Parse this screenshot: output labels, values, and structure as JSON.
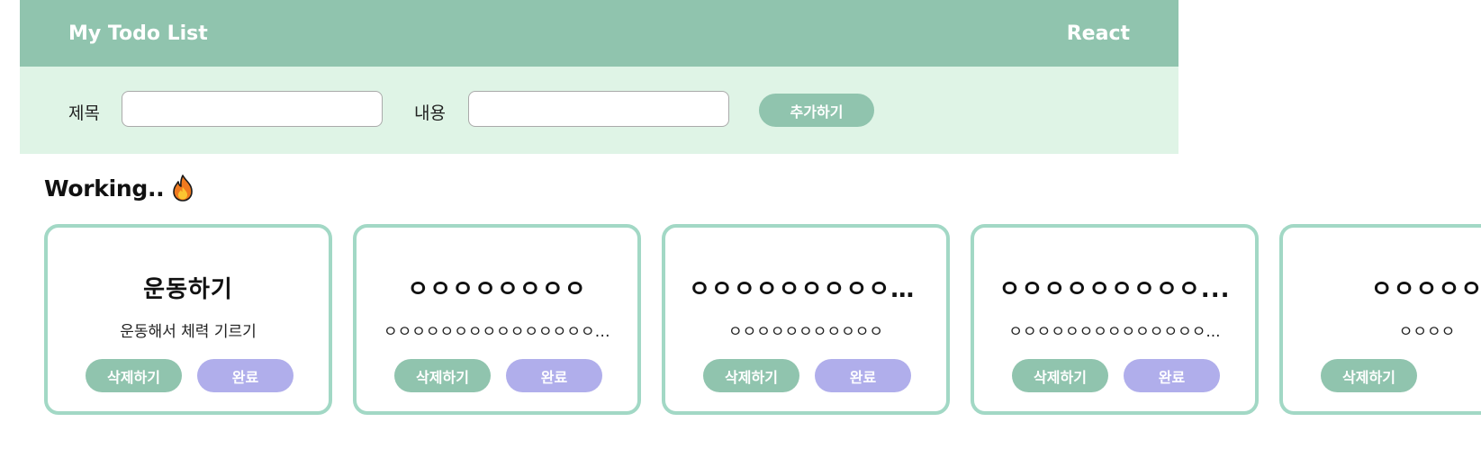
{
  "header": {
    "title": "My Todo List",
    "right_label": "React"
  },
  "form": {
    "title_label": "제목",
    "title_value": "",
    "content_label": "내용",
    "content_value": "",
    "add_label": "추가하기"
  },
  "section": {
    "title": "Working..",
    "icon": "fire-icon"
  },
  "cards": [
    {
      "title": "운동하기",
      "body": "운동해서 체력 기르기",
      "delete_label": "삭제하기",
      "done_label": "완료"
    },
    {
      "title": "ㅇㅇㅇㅇㅇㅇㅇㅇ",
      "body": "ㅇㅇㅇㅇㅇㅇㅇㅇㅇㅇㅇㅇㅇㅇㅇㅇㅇ",
      "delete_label": "삭제하기",
      "done_label": "완료"
    },
    {
      "title": "ㅇㅇㅇㅇㅇㅇㅇㅇㅇㅇ...",
      "body": "ㅇㅇㅇㅇㅇㅇㅇㅇㅇㅇㅇ",
      "delete_label": "삭제하기",
      "done_label": "완료"
    },
    {
      "title": "ㅇㅇㅇㅇㅇㅇㅇㅇㅇ...",
      "body": "ㅇㅇㅇㅇㅇㅇㅇㅇㅇㅇㅇㅇㅇㅇ...",
      "delete_label": "삭제하기",
      "done_label": "완료"
    },
    {
      "title": "ㅇㅇㅇㅇㅇ",
      "body": "ㅇㅇㅇㅇ",
      "delete_label": "삭제하기",
      "done_label": ""
    }
  ],
  "colors": {
    "header_bg": "#90c4ae",
    "form_bg": "#dff4e6",
    "card_border": "#a2d8c5",
    "delete_button": "#90c4ae",
    "done_button": "#b0aeeb"
  }
}
